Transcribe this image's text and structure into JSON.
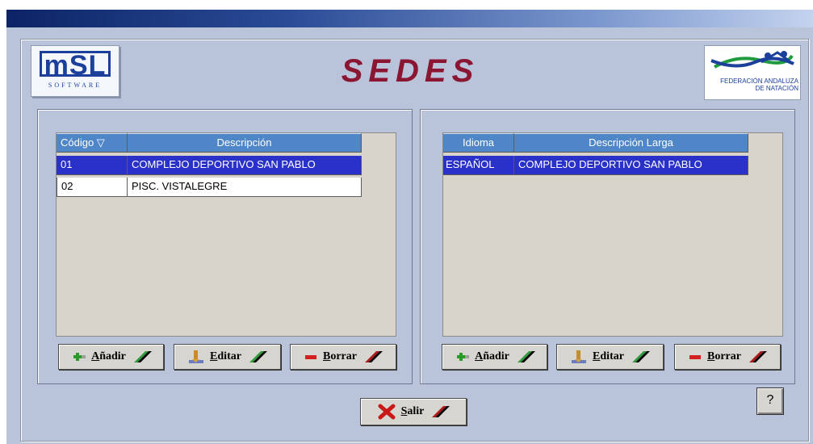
{
  "header": {
    "title": "SEDES",
    "logo_left": {
      "main": "mSL",
      "sub": "SOFTWARE"
    },
    "logo_right": {
      "line1": "FEDERACIÓN ANDALUZA",
      "line2": "DE NATACIÓN"
    }
  },
  "left_table": {
    "columns": [
      "Código ▽",
      "Descripción"
    ],
    "rows": [
      {
        "codigo": "01",
        "descripcion": "COMPLEJO DEPORTIVO SAN PABLO",
        "selected": true
      },
      {
        "codigo": "02",
        "descripcion": "PISC. VISTALEGRE",
        "selected": false
      }
    ]
  },
  "right_table": {
    "columns": [
      "Idioma",
      "Descripción Larga"
    ],
    "rows": [
      {
        "idioma": "ESPAÑOL",
        "descripcion_larga": "COMPLEJO DEPORTIVO SAN PABLO",
        "selected": true
      }
    ]
  },
  "left_buttons": {
    "add": "Añadir",
    "edit": "Editar",
    "delete": "Borrar"
  },
  "right_buttons": {
    "add": "Añadir",
    "edit": "Editar",
    "delete": "Borrar"
  },
  "footer": {
    "exit": "Salir",
    "help": "?"
  },
  "colors": {
    "title": "#8a1632",
    "header_cell": "#4f86c8",
    "selected_row": "#2a31c8",
    "window_bg": "#b9c3da"
  },
  "icons": {
    "add": "plus-icon",
    "edit": "edit-icon",
    "delete": "minus-icon",
    "exit": "x-icon",
    "flag": "slash-flag-icon"
  }
}
